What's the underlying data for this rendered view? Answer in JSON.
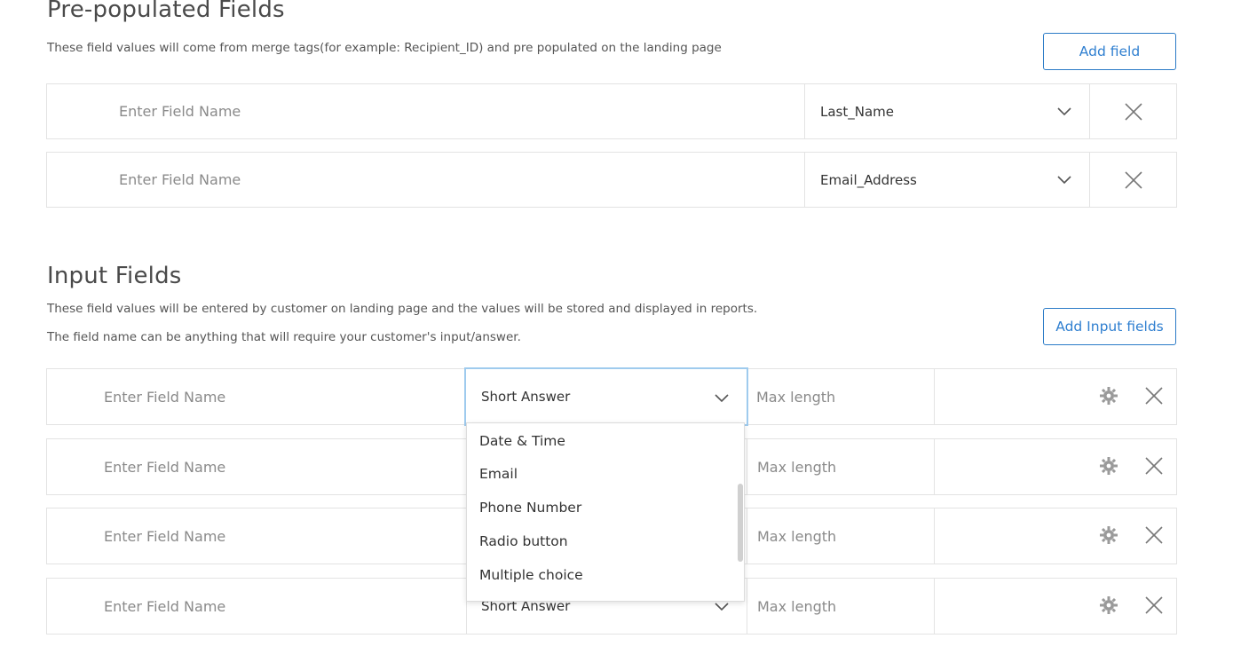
{
  "prepopulated": {
    "title": "Pre-populated Fields",
    "description": "These field values will come from merge tags(for example: Recipient_ID) and pre populated on the landing page",
    "add_button": "Add field",
    "rows": [
      {
        "name_placeholder": "Enter Field Name",
        "tag": "Last_Name"
      },
      {
        "name_placeholder": "Enter Field Name",
        "tag": "Email_Address"
      }
    ]
  },
  "input_fields": {
    "title": "Input Fields",
    "description_1": "These field values will be entered by customer on landing page and the values will be stored and displayed in reports.",
    "description_2": "The field name can be anything that will require your customer's input/answer.",
    "add_button": "Add Input fields",
    "rows": [
      {
        "name_placeholder": "Enter Field Name",
        "type": "Short Answer",
        "max_placeholder": "Max length"
      },
      {
        "name_placeholder": "Enter Field Name",
        "type": "",
        "max_placeholder": "Max length"
      },
      {
        "name_placeholder": "Enter Field Name",
        "type": "",
        "max_placeholder": "Max length"
      },
      {
        "name_placeholder": "Enter Field Name",
        "type": "Short Answer",
        "max_placeholder": "Max length"
      }
    ],
    "dropdown_options": [
      "Date & Time",
      "Email",
      "Phone Number",
      "Radio button",
      "Multiple choice"
    ]
  },
  "colors": {
    "accent": "#2f7fd0",
    "focus_border": "#9fcbee",
    "border": "#e3e3e3"
  },
  "icons": {
    "chevron": "chevron-down-icon",
    "close": "close-icon",
    "settings": "gear-icon"
  }
}
